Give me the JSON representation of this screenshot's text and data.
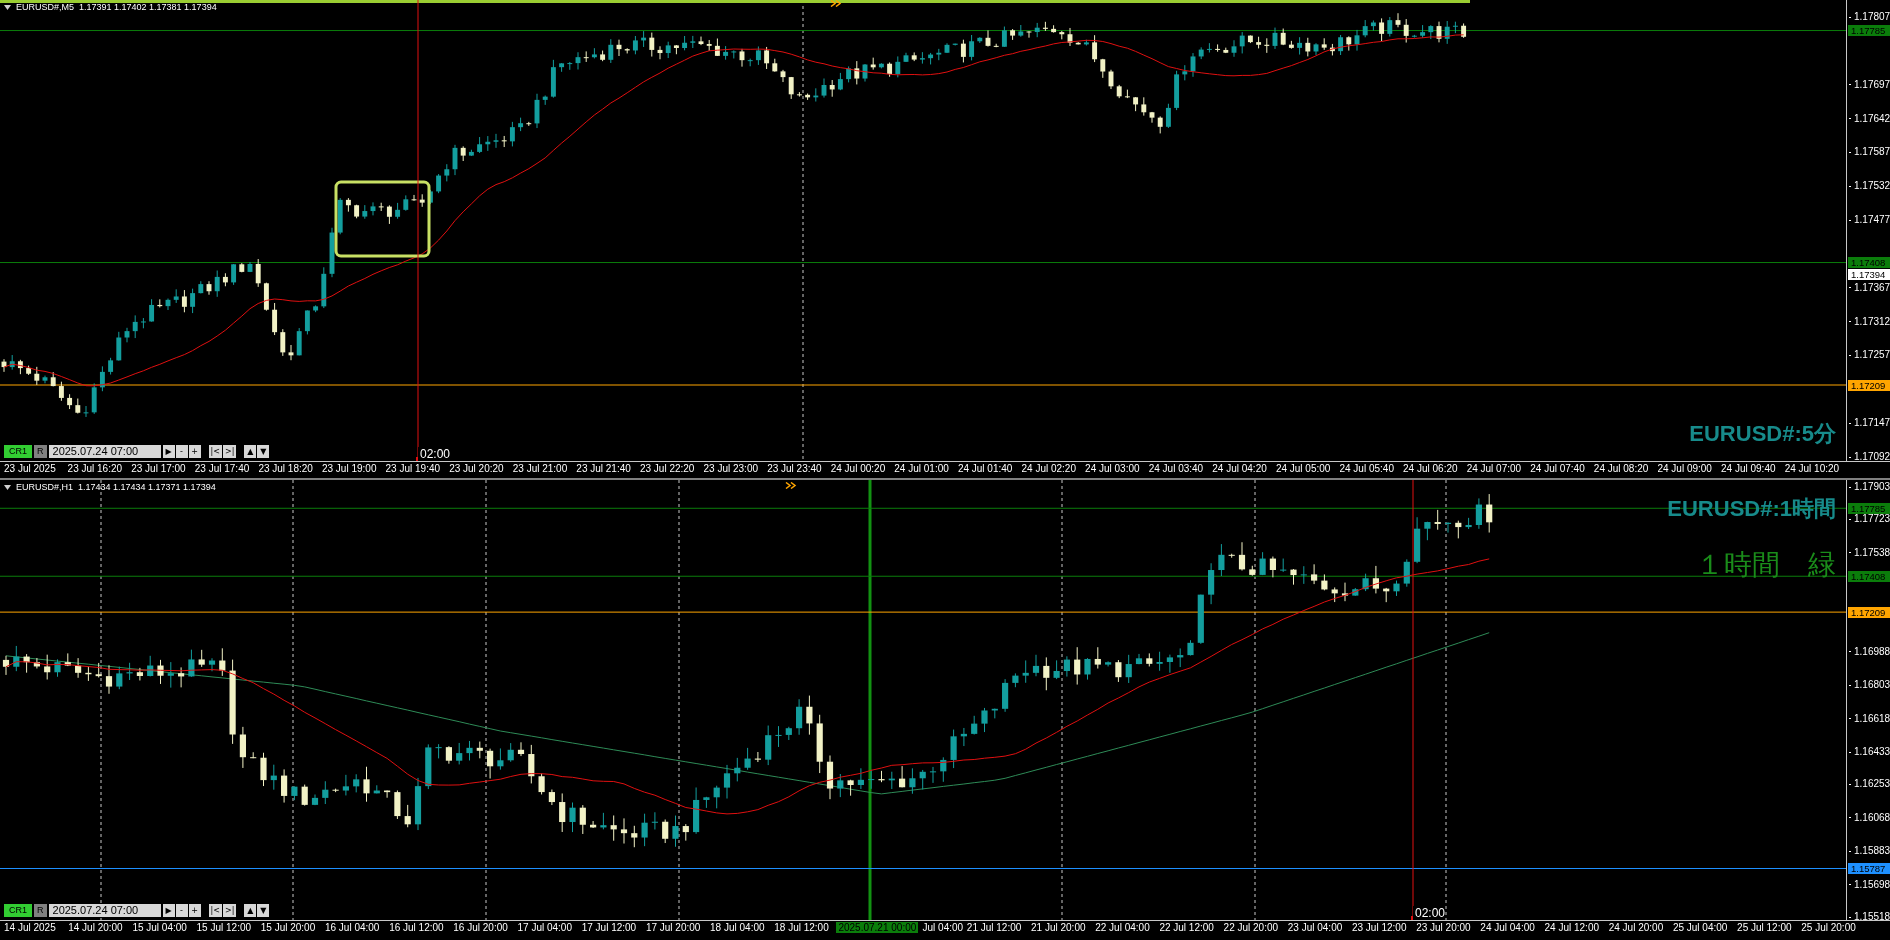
{
  "panels": [
    {
      "header": "EURUSD#,M5  1.17391 1.17402 1.17381 1.17394",
      "captions": [
        {
          "text": "EURUSD#:5分",
          "kind": "symbol"
        }
      ],
      "price_ticks": [
        "1.17807",
        "1.17697",
        "1.17642",
        "1.17587",
        "1.17532",
        "1.17477",
        "1.17367",
        "1.17312",
        "1.17257",
        "1.17147",
        "1.17092"
      ],
      "levels": [
        {
          "price": "1.17785",
          "color": "#0b7d0b",
          "kind": "line"
        },
        {
          "price": "1.17408",
          "color": "#0b7d0b",
          "kind": "line"
        },
        {
          "price": "1.17394",
          "color": "#ffffff",
          "kind": "bid"
        },
        {
          "price": "1.17209",
          "color": "#ffa500",
          "kind": "line"
        }
      ],
      "cursor_time": "02:00",
      "nav": {
        "profile": "CR1",
        "reset": "R",
        "date": "2025.07.24 07:00",
        "buttons": [
          [
            "▶",
            "-",
            "+"
          ],
          [
            "|<",
            ">|"
          ],
          [
            "▲",
            "▼"
          ]
        ]
      },
      "time_labels": [
        {
          "text": "23 Jul 2025",
          "kind": "tick"
        },
        {
          "text": "23 Jul 16:20",
          "kind": "tick"
        },
        {
          "text": "23 Jul 17:00",
          "kind": "tick"
        },
        {
          "text": "23 Jul 17:40",
          "kind": "tick"
        },
        {
          "text": "23 Jul 18:20",
          "kind": "tick"
        },
        {
          "text": "23 Jul 19:00",
          "kind": "tick"
        },
        {
          "text": "23 Jul 19:40",
          "kind": "tick"
        },
        {
          "text": "23 Jul 20:20",
          "kind": "tick"
        },
        {
          "text": "23 Jul 21:00",
          "kind": "tick"
        },
        {
          "text": "23 Jul 21:40",
          "kind": "tick"
        },
        {
          "text": "23 Jul 22:20",
          "kind": "tick"
        },
        {
          "text": "23 Jul 23:00",
          "kind": "tick"
        },
        {
          "text": "23 Jul 23:40",
          "kind": "tick"
        },
        {
          "text": "24 Jul 00:20",
          "kind": "tick"
        },
        {
          "text": "24 Jul 01:00",
          "kind": "tick"
        },
        {
          "text": "24 Jul 01:40",
          "kind": "tick"
        },
        {
          "text": "24 Jul 02:20",
          "kind": "tick"
        },
        {
          "text": "24 Jul 03:00",
          "kind": "tick"
        },
        {
          "text": "24 Jul 03:40",
          "kind": "tick"
        },
        {
          "text": "24 Jul 04:20",
          "kind": "tick"
        },
        {
          "text": "24 Jul 05:00",
          "kind": "tick"
        },
        {
          "text": "24 Jul 05:40",
          "kind": "tick"
        },
        {
          "text": "24 Jul 06:20",
          "kind": "tick"
        },
        {
          "text": "24 Jul 07:00",
          "kind": "tick"
        },
        {
          "text": "24 Jul 07:40",
          "kind": "tick"
        },
        {
          "text": "24 Jul 08:20",
          "kind": "tick"
        },
        {
          "text": "24 Jul 09:00",
          "kind": "tick"
        },
        {
          "text": "24 Jul 09:40",
          "kind": "tick"
        },
        {
          "text": "24 Jul 10:20",
          "kind": "tick"
        }
      ]
    },
    {
      "header": "EURUSD#,H1  1.17434 1.17434 1.17371 1.17394",
      "captions": [
        {
          "text": "EURUSD#:1時間",
          "kind": "symbol"
        },
        {
          "text": "１時間　緑",
          "kind": "note"
        }
      ],
      "price_ticks": [
        "1.17903",
        "1.17723",
        "1.17538",
        "1.16988",
        "1.16803",
        "1.16618",
        "1.16433",
        "1.16253",
        "1.16068",
        "1.15883",
        "1.15698",
        "1.15518"
      ],
      "levels": [
        {
          "price": "1.17785",
          "color": "#0b7d0b",
          "kind": "line"
        },
        {
          "price": "1.17408",
          "color": "#0b7d0b",
          "kind": "line"
        },
        {
          "price": "1.17209",
          "color": "#ffa500",
          "kind": "line"
        },
        {
          "price": "1.15787",
          "color": "#1e90ff",
          "kind": "line"
        }
      ],
      "cursor_time": "02:00",
      "nav": {
        "profile": "CR1",
        "reset": "R",
        "date": "2025.07.24 07:00",
        "buttons": [
          [
            "▶",
            "-",
            "+"
          ],
          [
            "|<",
            ">|"
          ],
          [
            "▲",
            "▼"
          ]
        ]
      },
      "time_labels": [
        {
          "text": "14 Jul 2025",
          "kind": "tick"
        },
        {
          "text": "14 Jul 20:00",
          "kind": "tick"
        },
        {
          "text": "15 Jul 04:00",
          "kind": "tick"
        },
        {
          "text": "15 Jul 12:00",
          "kind": "tick"
        },
        {
          "text": "15 Jul 20:00",
          "kind": "tick"
        },
        {
          "text": "16 Jul 04:00",
          "kind": "tick"
        },
        {
          "text": "16 Jul 12:00",
          "kind": "tick"
        },
        {
          "text": "16 Jul 20:00",
          "kind": "tick"
        },
        {
          "text": "17 Jul 04:00",
          "kind": "tick"
        },
        {
          "text": "17 Jul 12:00",
          "kind": "tick"
        },
        {
          "text": "17 Jul 20:00",
          "kind": "tick"
        },
        {
          "text": "18 Jul 04:00",
          "kind": "tick"
        },
        {
          "text": "18 Jul 12:00",
          "kind": "tick"
        },
        {
          "text": "2025.07.21 00:00",
          "kind": "cursor"
        },
        {
          "text": "Jul 04:00",
          "kind": "tick"
        },
        {
          "text": "21 Jul 12:00",
          "kind": "tick"
        },
        {
          "text": "21 Jul 20:00",
          "kind": "tick"
        },
        {
          "text": "22 Jul 04:00",
          "kind": "tick"
        },
        {
          "text": "22 Jul 12:00",
          "kind": "tick"
        },
        {
          "text": "22 Jul 20:00",
          "kind": "tick"
        },
        {
          "text": "23 Jul 04:00",
          "kind": "tick"
        },
        {
          "text": "23 Jul 12:00",
          "kind": "tick"
        },
        {
          "text": "23 Jul 20:00",
          "kind": "tick"
        },
        {
          "text": "24 Jul 04:00",
          "kind": "tick"
        },
        {
          "text": "24 Jul 12:00",
          "kind": "tick"
        },
        {
          "text": "24 Jul 20:00",
          "kind": "tick"
        },
        {
          "text": "25 Jul 04:00",
          "kind": "tick"
        },
        {
          "text": "25 Jul 12:00",
          "kind": "tick"
        },
        {
          "text": "25 Jul 20:00",
          "kind": "tick"
        }
      ]
    }
  ]
}
